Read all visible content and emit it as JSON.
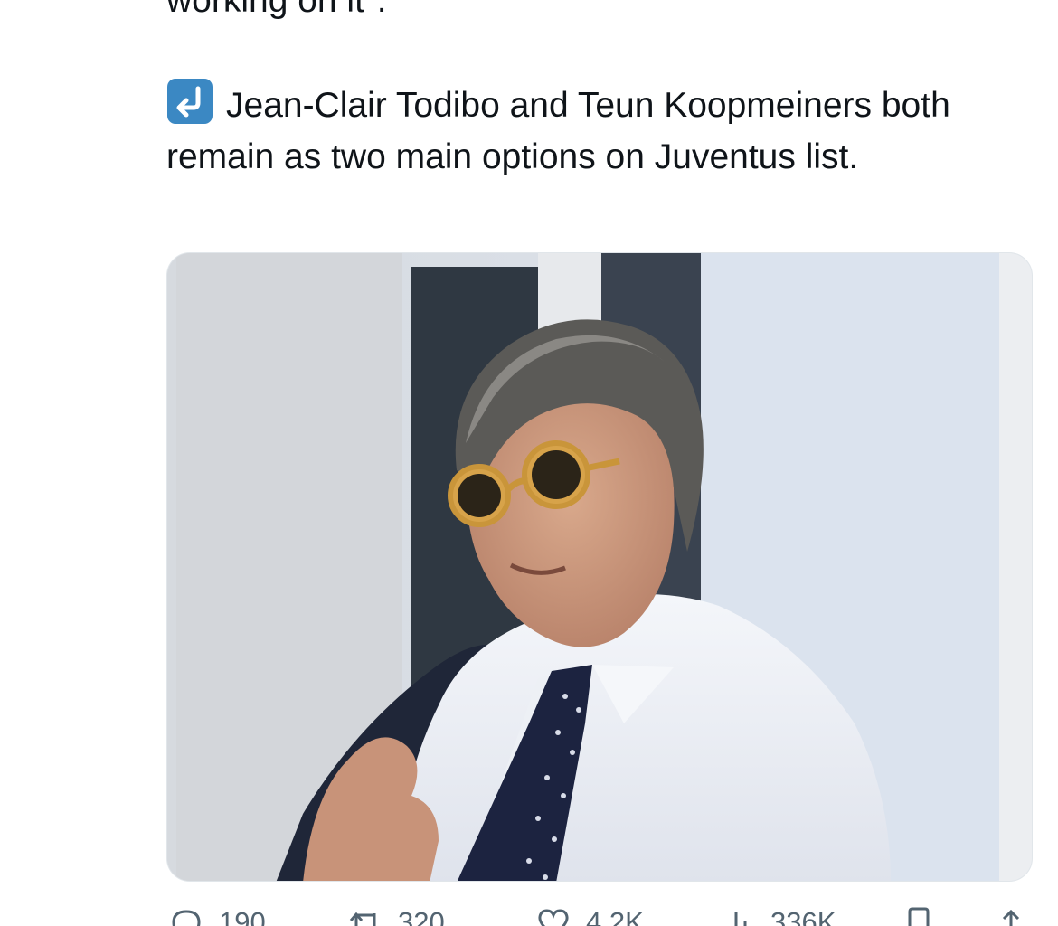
{
  "tweet": {
    "previous_line": "working on it\".",
    "emoji": "right-arrow-curving-left-icon",
    "text": "Jean-Clair Todibo and Teun Koopmeiners both remain as two main options on Juventus list."
  },
  "actions": {
    "reply_count": "190",
    "retweet_count": "320",
    "like_count": "4.2K",
    "views_count": "336K"
  },
  "colors": {
    "text": "#0f1419",
    "secondary": "#536471",
    "emoji_blue": "#3b88c3"
  }
}
